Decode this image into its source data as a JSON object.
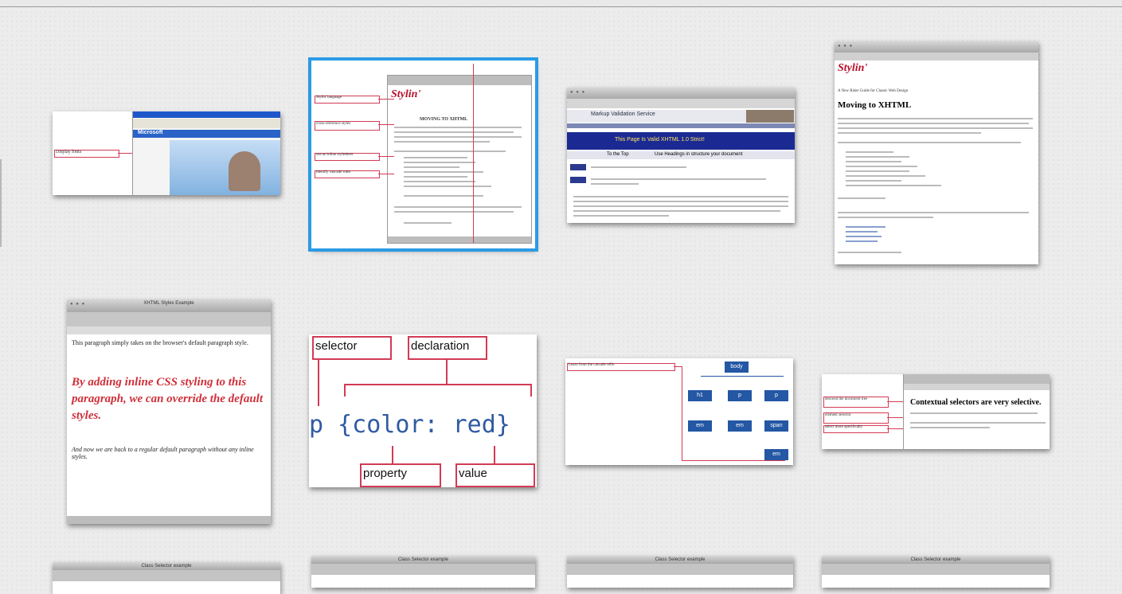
{
  "slides": [
    {
      "id": 1,
      "caption": "Display fonts",
      "banner": "Microsoft"
    },
    {
      "id": 2,
      "header": "Stylin'",
      "heading": "MOVING TO XHTML",
      "labels": [
        "Stylin' language",
        "cross-reference styles",
        "use an inline stylesheet",
        "identify cascade rules"
      ]
    },
    {
      "id": 3,
      "title": "Markup Validation Service",
      "banner": "This Page Is Valid XHTML 1.0 Strict!",
      "btn1": "To the Top",
      "btn2": "Use Headings in structure your document"
    },
    {
      "id": 4,
      "header": "Stylin'",
      "sub": "A New Rider Guide for Classic Web Design",
      "heading": "Moving to XHTML"
    },
    {
      "id": 5,
      "window_title": "XHTML Styles Example",
      "para1": "This paragraph simply takes on the browser's default paragraph style.",
      "para_styled": "By adding inline CSS styling to this paragraph, we can override the default styles.",
      "para2": "And now we are back to a regular default paragraph without any inline styles."
    },
    {
      "id": 6,
      "selector_label": "selector",
      "declaration_label": "declaration",
      "property_label": "property",
      "value_label": "value",
      "code": "p {color: red}"
    },
    {
      "id": 7,
      "note": "Learn from the cascade reflo",
      "nodes": [
        "body",
        "h1",
        "p",
        "p",
        "em",
        "em",
        "span",
        "em"
      ]
    },
    {
      "id": 8,
      "heading": "Contextual selectors are very selective.",
      "notes": [
        "descend the document tree",
        "element selector",
        "select more specifically"
      ]
    },
    {
      "id": 9,
      "window_title": "Class Selector example"
    },
    {
      "id": 10,
      "window_title": "Class Selector example"
    },
    {
      "id": 11,
      "window_title": "Class Selector example"
    },
    {
      "id": 12,
      "window_title": "Class Selector example"
    }
  ]
}
